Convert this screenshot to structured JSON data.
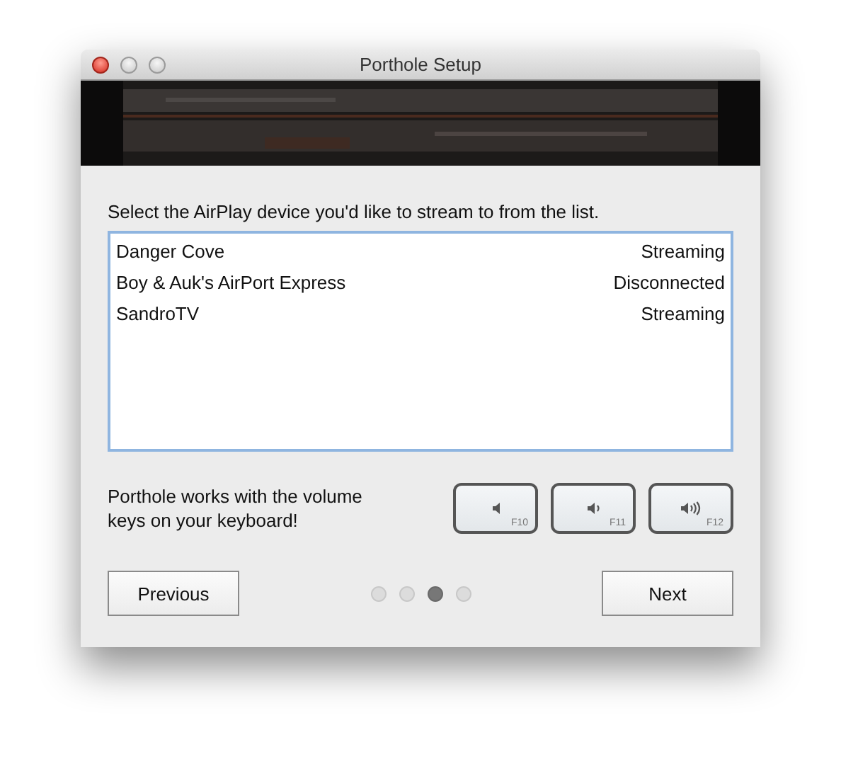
{
  "window": {
    "title": "Porthole Setup"
  },
  "instruction": "Select the AirPlay device you'd like to stream to from the list.",
  "devices": [
    {
      "name": "Danger Cove",
      "status": "Streaming"
    },
    {
      "name": "Boy & Auk's AirPort Express",
      "status": "Disconnected"
    },
    {
      "name": "SandroTV",
      "status": "Streaming"
    }
  ],
  "volume_note": "Porthole works with the volume keys on your keyboard!",
  "keys": [
    {
      "kind": "mute",
      "label": "F10"
    },
    {
      "kind": "down",
      "label": "F11"
    },
    {
      "kind": "up",
      "label": "F12"
    }
  ],
  "buttons": {
    "previous": "Previous",
    "next": "Next"
  },
  "pages": [
    {
      "selected": false
    },
    {
      "selected": false
    },
    {
      "selected": true
    },
    {
      "selected": false
    }
  ]
}
